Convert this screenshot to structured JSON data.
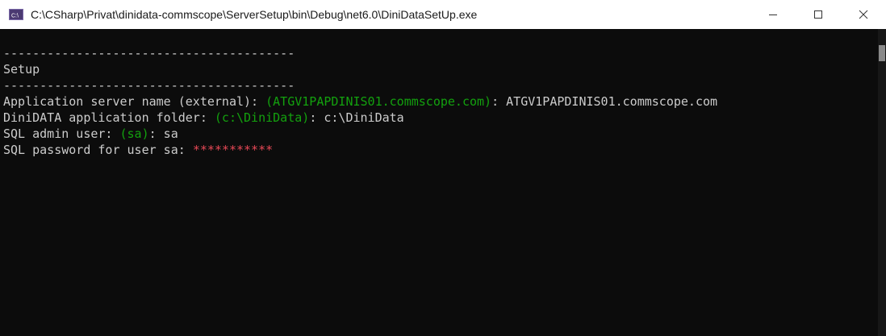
{
  "window": {
    "title": "C:\\CSharp\\Privat\\dinidata-commscope\\ServerSetup\\bin\\Debug\\net6.0\\DiniDataSetUp.exe",
    "icon": "console-app-icon"
  },
  "controls": {
    "minimize": "minimize-icon",
    "maximize": "maximize-icon",
    "close": "close-icon"
  },
  "console": {
    "separator_top": "----------------------------------------",
    "heading": "Setup",
    "separator_bottom": "----------------------------------------",
    "server_prompt": "Application server name (external): ",
    "server_default": "(ATGV1PAPDINIS01.commscope.com)",
    "server_value": ": ATGV1PAPDINIS01.commscope.com",
    "folder_prompt": "DiniDATA application folder: ",
    "folder_default": "(c:\\DiniData)",
    "folder_value": ": c:\\DiniData",
    "sql_user_prompt": "SQL admin user: ",
    "sql_user_default": "(sa)",
    "sql_user_value": ": sa",
    "sql_password_prompt": "SQL password for user sa: ",
    "sql_password_masked": "***********"
  },
  "colors": {
    "background": "#0c0c0c",
    "text": "#cccccc",
    "default_value": "#13a10e",
    "password_mask": "#e74856"
  }
}
